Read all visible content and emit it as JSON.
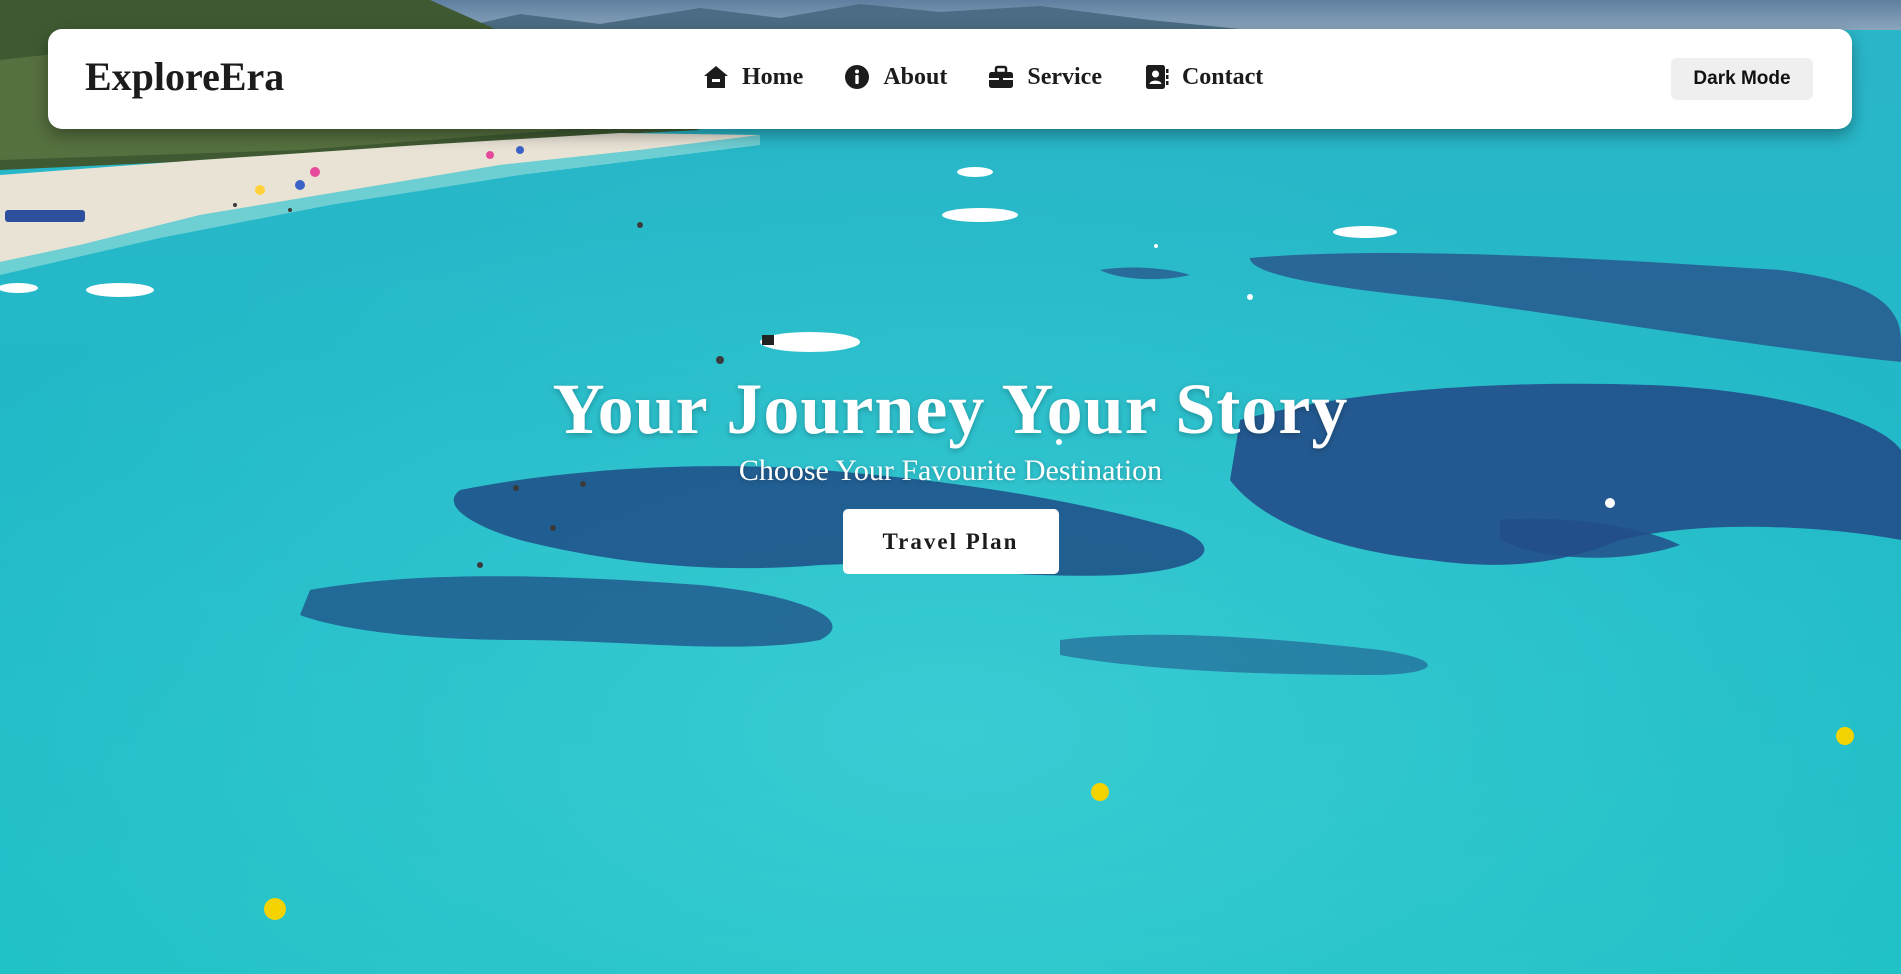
{
  "navbar": {
    "logo": "ExploreEra",
    "links": [
      {
        "label": "Home",
        "icon": "home-icon"
      },
      {
        "label": "About",
        "icon": "info-icon"
      },
      {
        "label": "Service",
        "icon": "briefcase-icon"
      },
      {
        "label": "Contact",
        "icon": "contact-book-icon"
      }
    ],
    "dark_mode_label": "Dark Mode"
  },
  "hero": {
    "title": "Your Journey Your Story",
    "subtitle": "Choose Your Favourite Destination",
    "cta_label": "Travel Plan",
    "background": "aerial-beach-ocean-video"
  },
  "colors": {
    "navbar_bg": "#ffffff",
    "text_dark": "#1c1c1c",
    "button_grey": "#efefef",
    "water": "#1fb6c4",
    "deep_water": "#1e4f8a",
    "sand": "#e9e3d6",
    "buoy": "#f5d300"
  }
}
